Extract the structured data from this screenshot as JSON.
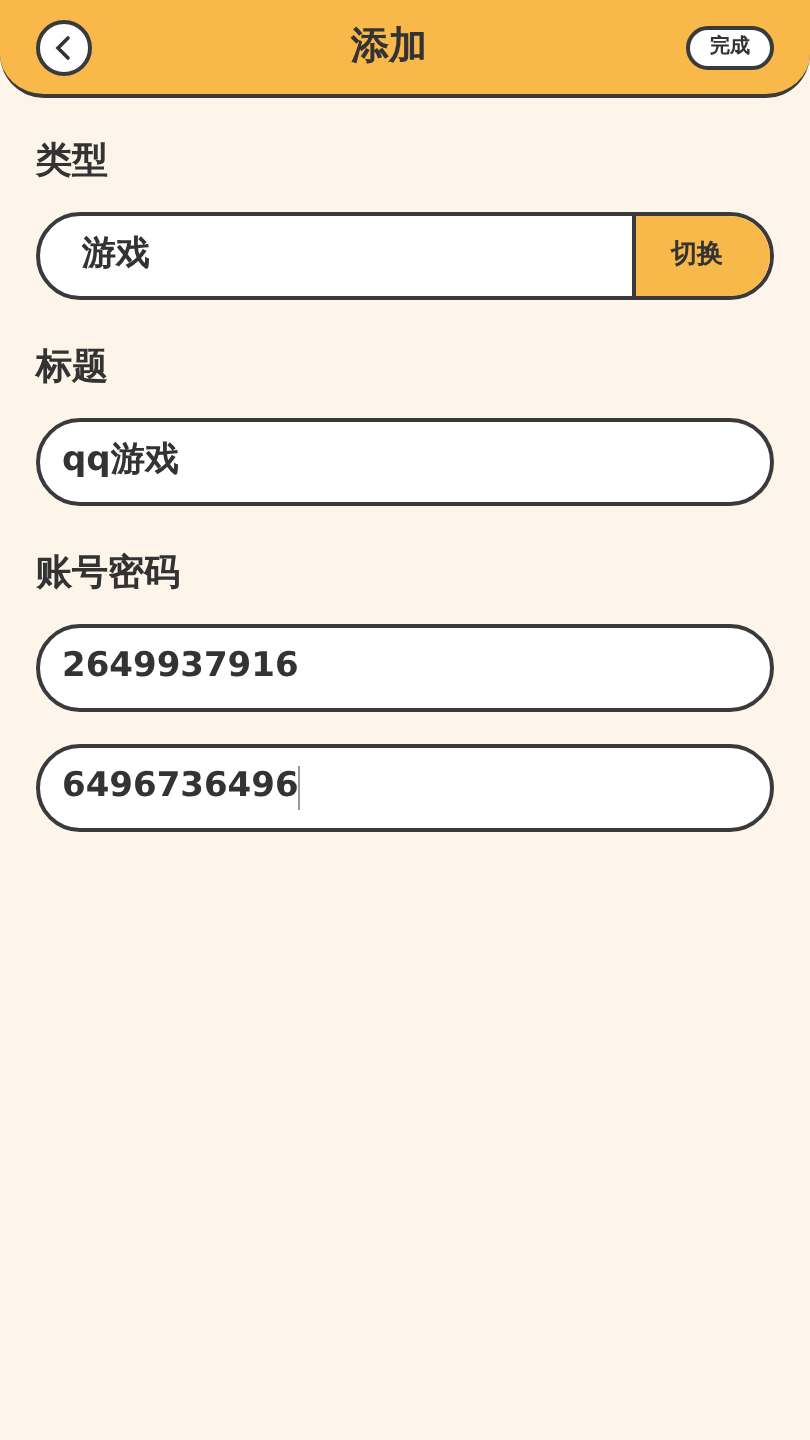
{
  "header": {
    "title": "添加",
    "done_button": "完成"
  },
  "type_section": {
    "label": "类型",
    "value": "游戏",
    "switch_button": "切换"
  },
  "title_section": {
    "label": "标题",
    "value": "qq游戏"
  },
  "account_section": {
    "label": "账号密码",
    "fields": [
      {
        "value": "2649937916",
        "focused": false
      },
      {
        "value": "6496736496",
        "focused": true
      }
    ]
  }
}
